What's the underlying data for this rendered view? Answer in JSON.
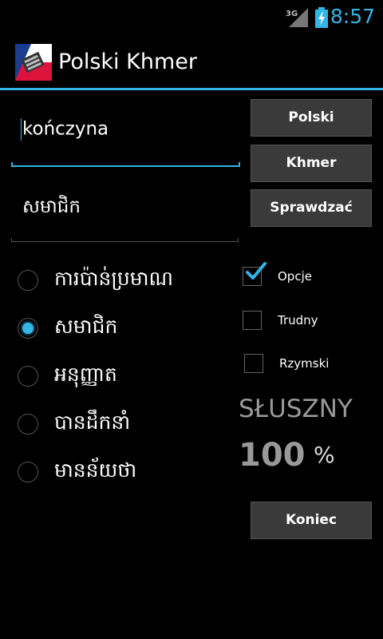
{
  "status": {
    "network": "3G",
    "time": "8:57"
  },
  "app": {
    "title": "Polski Khmer",
    "icon": "flag-keyboard-icon"
  },
  "inputs": {
    "source_value": "kończyna",
    "answer_value": "សមាជិក"
  },
  "buttons": {
    "polski": "Polski",
    "khmer": "Khmer",
    "check": "Sprawdzać",
    "end": "Koniec"
  },
  "options": [
    {
      "label": "ការប៉ាន់ប្រមាណ",
      "checked": false
    },
    {
      "label": "សមាជិក",
      "checked": true
    },
    {
      "label": "អនុញ្ញាត",
      "checked": false
    },
    {
      "label": "បានដឹកនាំ",
      "checked": false
    },
    {
      "label": "មានន័យថា",
      "checked": false
    }
  ],
  "settings": [
    {
      "label": "Opcje",
      "checked": true
    },
    {
      "label": "Trudny",
      "checked": false
    },
    {
      "label": "Rzymski",
      "checked": false
    }
  ],
  "result": {
    "label": "SŁUSZNY",
    "value": "100",
    "unit": "%"
  },
  "colors": {
    "accent": "#33b5e5",
    "background": "#000000",
    "button": "#3a3a3a"
  }
}
